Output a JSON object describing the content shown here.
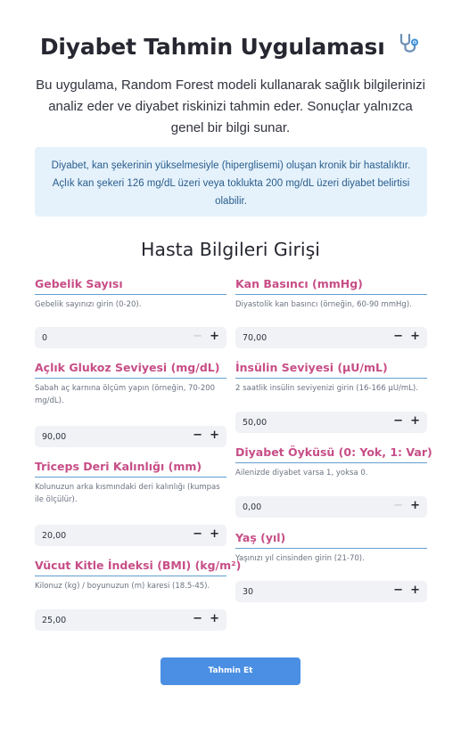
{
  "app": {
    "title": "Diyabet Tahmin Uygulaması",
    "title_icon": "stethoscope-icon",
    "intro": "Bu uygulama, Random Forest modeli kullanarak sağlık bilgilerinizi analiz eder ve diyabet riskinizi tahmin eder. Sonuçlar yalnızca genel bir bilgi sunar.",
    "info": "Diyabet, kan şekerinin yükselmesiyle (hiperglisemi) oluşan kronik bir hastalıktır. Açlık kan şekeri 126 mg/dL üzeri veya toklukta 200 mg/dL üzeri diyabet belirtisi olabilir.",
    "section_title": "Hasta Bilgileri Girişi",
    "submit_label": "Tahmin Et"
  },
  "fields": {
    "pregnancies": {
      "label": "Gebelik Sayısı",
      "help": "Gebelik sayınızı girin (0-20).",
      "value": "0",
      "minus": "−",
      "plus": "+"
    },
    "glucose": {
      "label": "Açlık Glukoz Seviyesi (mg/dL)",
      "help": "Sabah aç karnına ölçüm yapın (örneğin, 70-200 mg/dL).",
      "value": "90,00",
      "minus": "−",
      "plus": "+"
    },
    "skin": {
      "label": "Triceps Deri Kalınlığı (mm)",
      "help": "Kolunuzun arka kısmındaki deri kalınlığı (kumpas ile ölçülür).",
      "value": "20,00",
      "minus": "−",
      "plus": "+"
    },
    "bmi": {
      "label": "Vücut Kitle İndeksi (BMI) (kg/m²)",
      "help": "Kilonuz (kg) / boyunuzun (m) karesi (18.5-45).",
      "value": "25,00",
      "minus": "−",
      "plus": "+"
    },
    "blood_pressure": {
      "label": "Kan Basıncı (mmHg)",
      "help": "Diyastolik kan basıncı (örneğin, 60-90 mmHg).",
      "value": "70,00",
      "minus": "−",
      "plus": "+"
    },
    "insulin": {
      "label": "İnsülin Seviyesi (µU/mL)",
      "help": "2 saatlik insülin seviyenizi girin (16-166 µU/mL).",
      "value": "50,00",
      "minus": "−",
      "plus": "+"
    },
    "pedigree": {
      "label": "Diyabet Öyküsü (0: Yok, 1: Var)",
      "help": "Ailenizde diyabet varsa 1, yoksa 0.",
      "value": "0,00",
      "minus": "−",
      "plus": "+"
    },
    "age": {
      "label": "Yaş (yıl)",
      "help": "Yaşınızı yıl cinsinden girin (21-70).",
      "value": "30",
      "minus": "−",
      "plus": "+"
    }
  }
}
